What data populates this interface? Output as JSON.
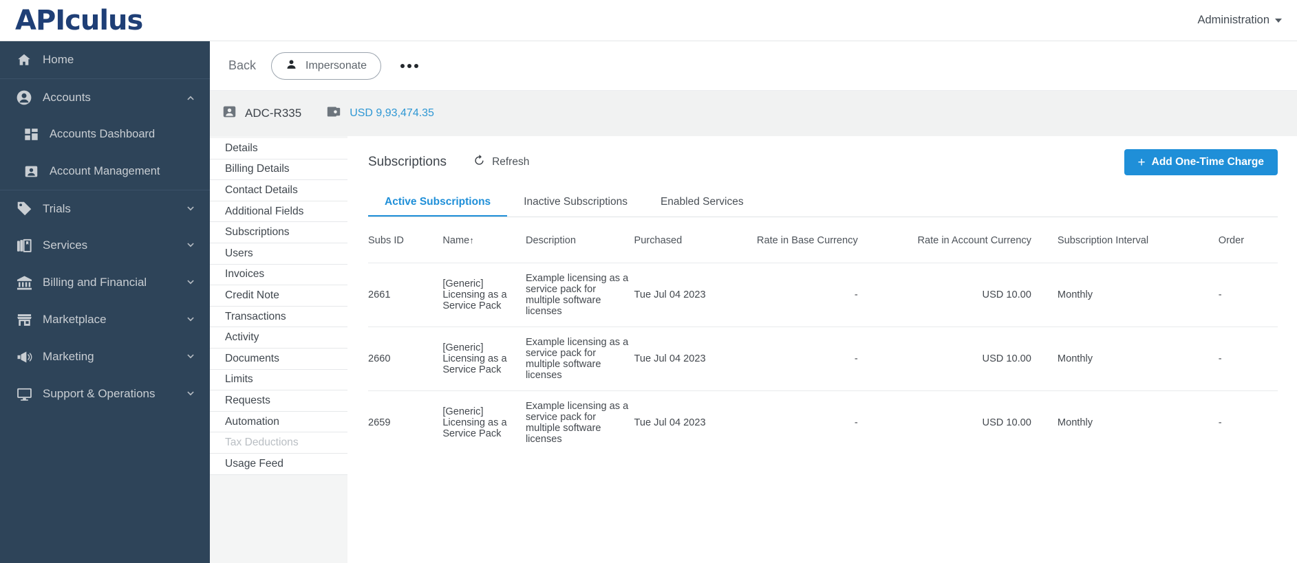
{
  "brand": {
    "logo": "APIculus",
    "accent": "#1f8fd8",
    "sidebar_bg": "#2e4459",
    "logo_color": "#1f3f76"
  },
  "topbar": {
    "admin_label": "Administration"
  },
  "sidebar": {
    "items": [
      {
        "label": "Home",
        "icon": "home-icon",
        "chevron": "",
        "sub": false,
        "sep": false
      },
      {
        "label": "Accounts",
        "icon": "account-circle-icon",
        "chevron": "up",
        "sub": false,
        "sep": true
      },
      {
        "label": "Accounts Dashboard",
        "icon": "dashboard-icon",
        "chevron": "",
        "sub": true,
        "sep": false
      },
      {
        "label": "Account Management",
        "icon": "contact-card-icon",
        "chevron": "",
        "sub": true,
        "sep": false
      },
      {
        "label": "Trials",
        "icon": "tag-icon",
        "chevron": "down",
        "sub": false,
        "sep": true
      },
      {
        "label": "Services",
        "icon": "layers-icon",
        "chevron": "down",
        "sub": false,
        "sep": false
      },
      {
        "label": "Billing and Financial",
        "icon": "bank-icon",
        "chevron": "down",
        "sub": false,
        "sep": false
      },
      {
        "label": "Marketplace",
        "icon": "store-icon",
        "chevron": "down",
        "sub": false,
        "sep": false
      },
      {
        "label": "Marketing",
        "icon": "megaphone-icon",
        "chevron": "down",
        "sub": false,
        "sep": false
      },
      {
        "label": "Support & Operations",
        "icon": "monitor-icon",
        "chevron": "down",
        "sub": false,
        "sep": false
      }
    ]
  },
  "action_bar": {
    "back_label": "Back",
    "impersonate_label": "Impersonate",
    "more_label": "More options"
  },
  "account_bar": {
    "account_id": "ADC-R335",
    "balance": "USD 9,93,474.35"
  },
  "subnav": {
    "items": [
      {
        "label": "Details",
        "disabled": false
      },
      {
        "label": "Billing Details",
        "disabled": false
      },
      {
        "label": "Contact Details",
        "disabled": false
      },
      {
        "label": "Additional Fields",
        "disabled": false
      },
      {
        "label": "Subscriptions",
        "disabled": false
      },
      {
        "label": "Users",
        "disabled": false
      },
      {
        "label": "Invoices",
        "disabled": false
      },
      {
        "label": "Credit Note",
        "disabled": false
      },
      {
        "label": "Transactions",
        "disabled": false
      },
      {
        "label": "Activity",
        "disabled": false
      },
      {
        "label": "Documents",
        "disabled": false
      },
      {
        "label": "Limits",
        "disabled": false
      },
      {
        "label": "Requests",
        "disabled": false
      },
      {
        "label": "Automation",
        "disabled": false
      },
      {
        "label": "Tax Deductions",
        "disabled": true
      },
      {
        "label": "Usage Feed",
        "disabled": false
      }
    ]
  },
  "main": {
    "title": "Subscriptions",
    "refresh_label": "Refresh",
    "add_charge_label": "Add One-Time Charge",
    "add_charge_plus": "+",
    "tabs": [
      {
        "label": "Active Subscriptions",
        "active": true
      },
      {
        "label": "Inactive Subscriptions",
        "active": false
      },
      {
        "label": "Enabled Services",
        "active": false
      }
    ],
    "table": {
      "columns": [
        "Subs ID",
        "Name",
        "Description",
        "Purchased",
        "Rate in Base Currency",
        "Rate in Account Currency",
        "Subscription Interval",
        "Order"
      ],
      "sort_column": "Name",
      "sort_arrow": "↑",
      "rows": [
        {
          "subs_id": "2661",
          "name": "[Generic] Licensing as a Service Pack",
          "description": "Example licensing as a service pack for multiple software licenses",
          "purchased": "Tue Jul 04 2023",
          "rate_base": "-",
          "rate_account": "USD 10.00",
          "interval": "Monthly",
          "order": "-"
        },
        {
          "subs_id": "2660",
          "name": "[Generic] Licensing as a Service Pack",
          "description": "Example licensing as a service pack for multiple software licenses",
          "purchased": "Tue Jul 04 2023",
          "rate_base": "-",
          "rate_account": "USD 10.00",
          "interval": "Monthly",
          "order": "-"
        },
        {
          "subs_id": "2659",
          "name": "[Generic] Licensing as a Service Pack",
          "description": "Example licensing as a service pack for multiple software licenses",
          "purchased": "Tue Jul 04 2023",
          "rate_base": "-",
          "rate_account": "USD 10.00",
          "interval": "Monthly",
          "order": "-"
        }
      ]
    }
  }
}
